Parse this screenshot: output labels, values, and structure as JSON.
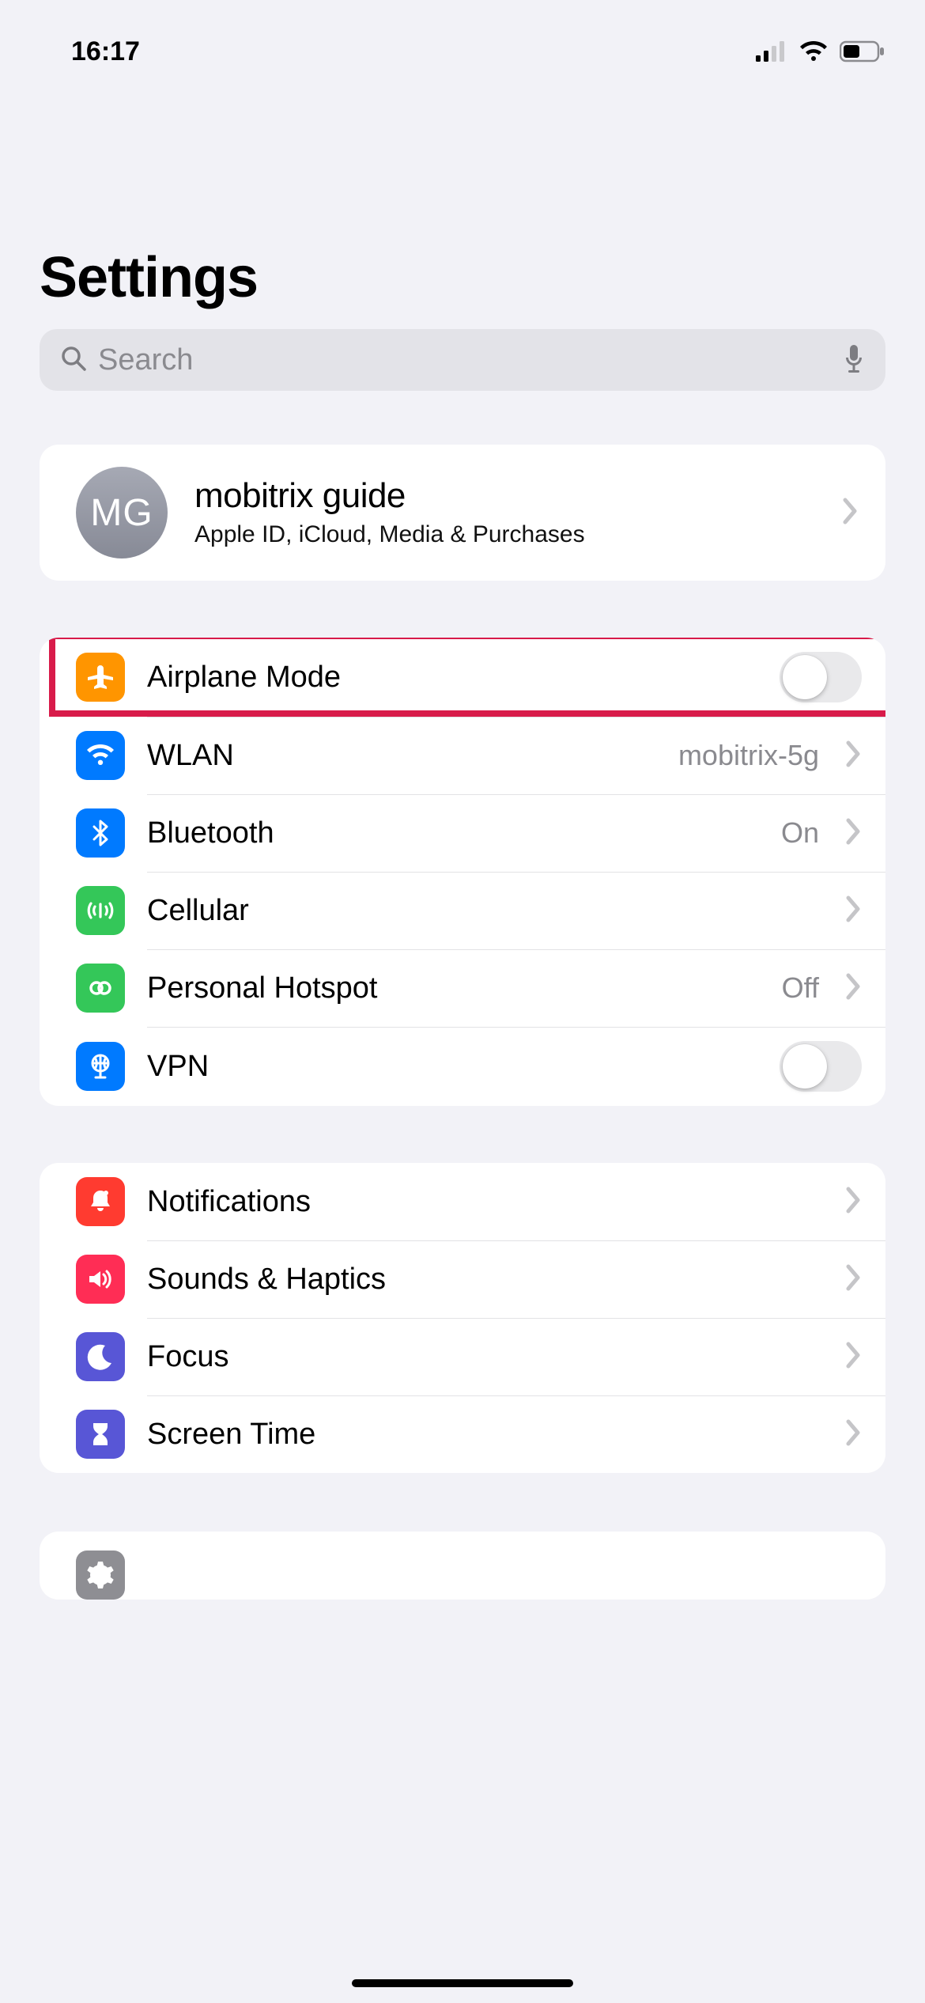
{
  "status": {
    "time": "16:17"
  },
  "header": {
    "title": "Settings"
  },
  "search": {
    "placeholder": "Search"
  },
  "profile": {
    "initials": "MG",
    "name": "mobitrix guide",
    "subtitle": "Apple ID, iCloud, Media & Purchases"
  },
  "connectivity": {
    "airplane": {
      "label": "Airplane Mode"
    },
    "wlan": {
      "label": "WLAN",
      "detail": "mobitrix-5g"
    },
    "bluetooth": {
      "label": "Bluetooth",
      "detail": "On"
    },
    "cellular": {
      "label": "Cellular"
    },
    "hotspot": {
      "label": "Personal Hotspot",
      "detail": "Off"
    },
    "vpn": {
      "label": "VPN"
    }
  },
  "attention": {
    "notifications": {
      "label": "Notifications"
    },
    "sounds": {
      "label": "Sounds & Haptics"
    },
    "focus": {
      "label": "Focus"
    },
    "screentime": {
      "label": "Screen Time"
    }
  }
}
